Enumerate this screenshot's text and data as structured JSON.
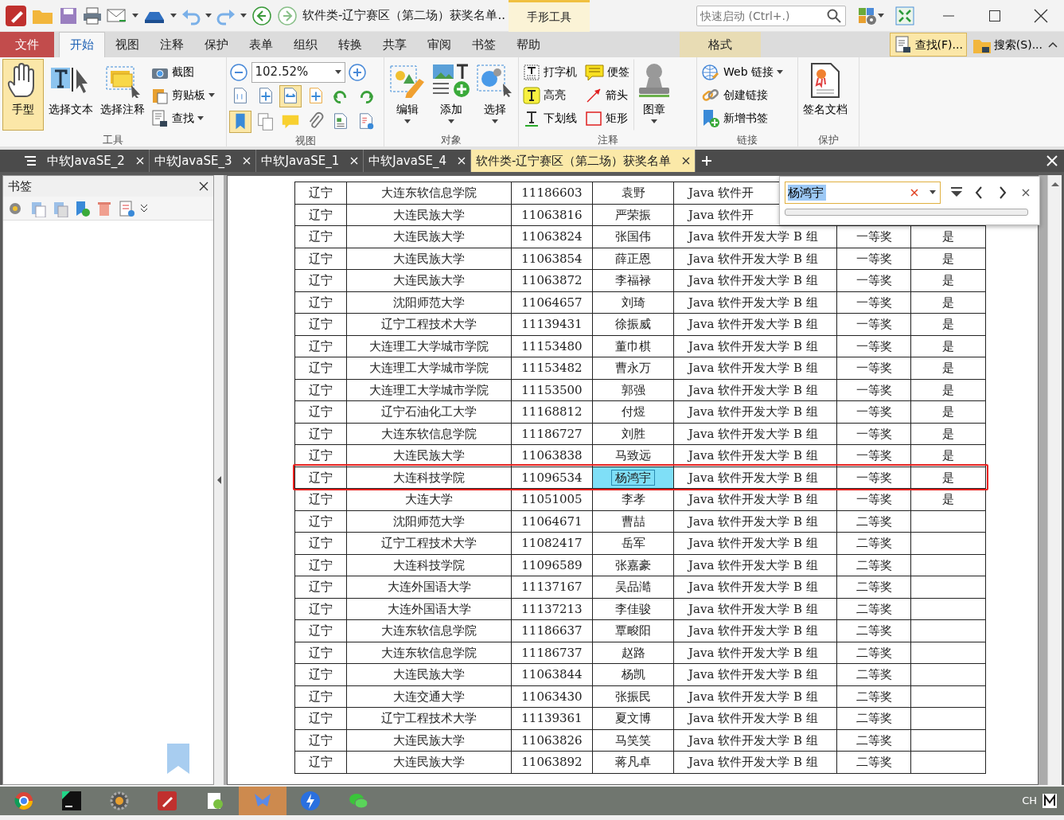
{
  "title_bar": {
    "document_title": "软件类-辽宁赛区（第二场）获奖名单..",
    "context_tab": "手形工具",
    "quick_launch": {
      "placeholder": "快速启动 (Ctrl+.)"
    }
  },
  "menu_tabs": [
    {
      "label": "文件",
      "kind": "file",
      "selected": false
    },
    {
      "label": "开始",
      "kind": "tab",
      "selected": true
    },
    {
      "label": "视图",
      "kind": "tab",
      "selected": false
    },
    {
      "label": "注释",
      "kind": "tab",
      "selected": false
    },
    {
      "label": "保护",
      "kind": "tab",
      "selected": false
    },
    {
      "label": "表单",
      "kind": "tab",
      "selected": false
    },
    {
      "label": "组织",
      "kind": "tab",
      "selected": false
    },
    {
      "label": "转换",
      "kind": "tab",
      "selected": false
    },
    {
      "label": "共享",
      "kind": "tab",
      "selected": false
    },
    {
      "label": "审阅",
      "kind": "tab",
      "selected": false
    },
    {
      "label": "书签",
      "kind": "tab",
      "selected": false
    },
    {
      "label": "帮助",
      "kind": "tab",
      "selected": false
    },
    {
      "label": "格式",
      "kind": "context",
      "selected": false
    }
  ],
  "ribbon_right": [
    {
      "label": "查找(F)...",
      "selected": true
    },
    {
      "label": "搜索(S)...",
      "selected": false
    }
  ],
  "ribbon_groups": [
    {
      "title": "工具",
      "kind": "buttons",
      "items": [
        {
          "label": "手型",
          "kind": "large",
          "selected": true
        },
        {
          "label": "选择文本",
          "kind": "large",
          "selected": false
        },
        {
          "label": "选择注释",
          "kind": "large",
          "selected": false
        },
        {
          "label": "截图",
          "kind": "small",
          "dropdown": false
        },
        {
          "label": "剪贴板",
          "kind": "small",
          "dropdown": true
        },
        {
          "label": "查找",
          "kind": "small",
          "dropdown": true
        }
      ]
    },
    {
      "title": "视图",
      "kind": "view",
      "zoom": "102.52%",
      "buttons_row1": [
        {
          "selected": false
        },
        {
          "selected": false
        },
        {
          "selected": true
        },
        {
          "selected": false
        },
        {
          "selected": false
        },
        {
          "selected": false
        }
      ],
      "buttons_row2": [
        {
          "selected": true
        },
        {
          "selected": false
        },
        {
          "selected": false
        },
        {
          "selected": false
        },
        {
          "selected": false
        },
        {
          "selected": false
        }
      ]
    },
    {
      "title": "对象",
      "kind": "buttons",
      "items": [
        {
          "label": "编辑",
          "kind": "large",
          "dropdown": true,
          "selected": false
        },
        {
          "label": "添加",
          "kind": "large",
          "dropdown": true,
          "selected": false
        },
        {
          "label": "选择",
          "kind": "large",
          "dropdown": true,
          "selected": false
        }
      ]
    },
    {
      "title": "注释",
      "kind": "grid",
      "items": [
        {
          "label": "打字机",
          "kind": "small"
        },
        {
          "label": "便签",
          "kind": "small"
        },
        {
          "label": "高亮",
          "kind": "small"
        },
        {
          "label": "箭头",
          "kind": "small"
        },
        {
          "label": "下划线",
          "kind": "small"
        },
        {
          "label": "矩形",
          "kind": "small"
        },
        {
          "label": "图章",
          "kind": "large",
          "dropdown": true,
          "selected": false
        }
      ]
    },
    {
      "title": "链接",
      "kind": "buttons",
      "items": [
        {
          "label": "Web 链接",
          "kind": "small",
          "dropdown": true
        },
        {
          "label": "创建链接",
          "kind": "small",
          "dropdown": false
        },
        {
          "label": "新增书签",
          "kind": "small",
          "dropdown": false
        }
      ]
    },
    {
      "title": "保护",
      "kind": "buttons",
      "items": [
        {
          "label": "签名文档",
          "kind": "large",
          "selected": false
        }
      ]
    }
  ],
  "doc_tabs": [
    {
      "label": "中软JavaSE_2",
      "selected": false
    },
    {
      "label": "中软JavaSE_3",
      "selected": false
    },
    {
      "label": "中软JavaSE_1",
      "selected": false
    },
    {
      "label": "中软JavaSE_4",
      "selected": false
    },
    {
      "label": "软件类-辽宁赛区（第二场）获奖名单",
      "selected": true
    }
  ],
  "bookmarks_panel": {
    "title": "书签"
  },
  "find_bar": {
    "value": "杨鸿宇",
    "level": 0
  },
  "table": {
    "rows": [
      {
        "cells": [
          "辽宁",
          "大连东软信息学院",
          "11186603",
          "袁野",
          "Java 软件开"
        ],
        "found": false
      },
      {
        "cells": [
          "辽宁",
          "大连民族大学",
          "11063816",
          "严荣振",
          "Java 软件开"
        ],
        "found": false
      },
      {
        "cells": [
          "辽宁",
          "大连民族大学",
          "11063824",
          "张国伟",
          "Java 软件开发大学 B 组",
          "一等奖",
          "是"
        ],
        "found": false
      },
      {
        "cells": [
          "辽宁",
          "大连民族大学",
          "11063854",
          "薛正恩",
          "Java 软件开发大学 B 组",
          "一等奖",
          "是"
        ],
        "found": false
      },
      {
        "cells": [
          "辽宁",
          "大连民族大学",
          "11063872",
          "李福禄",
          "Java 软件开发大学 B 组",
          "一等奖",
          "是"
        ],
        "found": false
      },
      {
        "cells": [
          "辽宁",
          "沈阳师范大学",
          "11064657",
          "刘琦",
          "Java 软件开发大学 B 组",
          "一等奖",
          "是"
        ],
        "found": false
      },
      {
        "cells": [
          "辽宁",
          "辽宁工程技术大学",
          "11139431",
          "徐振威",
          "Java 软件开发大学 B 组",
          "一等奖",
          "是"
        ],
        "found": false
      },
      {
        "cells": [
          "辽宁",
          "大连理工大学城市学院",
          "11153480",
          "董巾棋",
          "Java 软件开发大学 B 组",
          "一等奖",
          "是"
        ],
        "found": false
      },
      {
        "cells": [
          "辽宁",
          "大连理工大学城市学院",
          "11153482",
          "曹永万",
          "Java 软件开发大学 B 组",
          "一等奖",
          "是"
        ],
        "found": false
      },
      {
        "cells": [
          "辽宁",
          "大连理工大学城市学院",
          "11153500",
          "郭强",
          "Java 软件开发大学 B 组",
          "一等奖",
          "是"
        ],
        "found": false
      },
      {
        "cells": [
          "辽宁",
          "辽宁石油化工大学",
          "11168812",
          "付煜",
          "Java 软件开发大学 B 组",
          "一等奖",
          "是"
        ],
        "found": false
      },
      {
        "cells": [
          "辽宁",
          "大连东软信息学院",
          "11186727",
          "刘胜",
          "Java 软件开发大学 B 组",
          "一等奖",
          "是"
        ],
        "found": false
      },
      {
        "cells": [
          "辽宁",
          "大连民族大学",
          "11063838",
          "马致远",
          "Java 软件开发大学 B 组",
          "一等奖",
          "是"
        ],
        "found": false
      },
      {
        "cells": [
          "辽宁",
          "大连科技学院",
          "11096534",
          "杨鸿宇",
          "Java 软件开发大学 B 组",
          "一等奖",
          "是"
        ],
        "found": true
      },
      {
        "cells": [
          "辽宁",
          "大连大学",
          "11051005",
          "李孝",
          "Java 软件开发大学 B 组",
          "一等奖",
          "是"
        ],
        "found": false
      },
      {
        "cells": [
          "辽宁",
          "沈阳师范大学",
          "11064671",
          "曹喆",
          "Java 软件开发大学 B 组",
          "二等奖"
        ],
        "found": false
      },
      {
        "cells": [
          "辽宁",
          "辽宁工程技术大学",
          "11082417",
          "岳军",
          "Java 软件开发大学 B 组",
          "二等奖"
        ],
        "found": false
      },
      {
        "cells": [
          "辽宁",
          "大连科技学院",
          "11096589",
          "张嘉豪",
          "Java 软件开发大学 B 组",
          "二等奖"
        ],
        "found": false
      },
      {
        "cells": [
          "辽宁",
          "大连外国语大学",
          "11137167",
          "吴品澔",
          "Java 软件开发大学 B 组",
          "二等奖"
        ],
        "found": false
      },
      {
        "cells": [
          "辽宁",
          "大连外国语大学",
          "11137213",
          "李佳骏",
          "Java 软件开发大学 B 组",
          "二等奖"
        ],
        "found": false
      },
      {
        "cells": [
          "辽宁",
          "大连东软信息学院",
          "11186637",
          "覃畯阳",
          "Java 软件开发大学 B 组",
          "二等奖"
        ],
        "found": false
      },
      {
        "cells": [
          "辽宁",
          "大连东软信息学院",
          "11186737",
          "赵路",
          "Java 软件开发大学 B 组",
          "二等奖"
        ],
        "found": false
      },
      {
        "cells": [
          "辽宁",
          "大连民族大学",
          "11063844",
          "杨凯",
          "Java 软件开发大学 B 组",
          "二等奖"
        ],
        "found": false
      },
      {
        "cells": [
          "辽宁",
          "大连交通大学",
          "11063430",
          "张振民",
          "Java 软件开发大学 B 组",
          "二等奖"
        ],
        "found": false
      },
      {
        "cells": [
          "辽宁",
          "辽宁工程技术大学",
          "11139361",
          "夏文博",
          "Java 软件开发大学 B 组",
          "二等奖"
        ],
        "found": false
      },
      {
        "cells": [
          "辽宁",
          "大连民族大学",
          "11063826",
          "马笑笑",
          "Java 软件开发大学 B 组",
          "二等奖"
        ],
        "found": false
      },
      {
        "cells": [
          "辽宁",
          "大连民族大学",
          "11063892",
          "蒋凡卓",
          "Java 软件开发大学 B 组",
          "二等奖"
        ],
        "found": false
      }
    ]
  },
  "taskbar": {
    "apps": [
      {
        "selected": false
      },
      {
        "selected": false
      },
      {
        "selected": false
      },
      {
        "selected": false
      },
      {
        "selected": false
      },
      {
        "selected": true
      },
      {
        "selected": false
      },
      {
        "selected": false
      }
    ],
    "input_indicator": "CH"
  }
}
